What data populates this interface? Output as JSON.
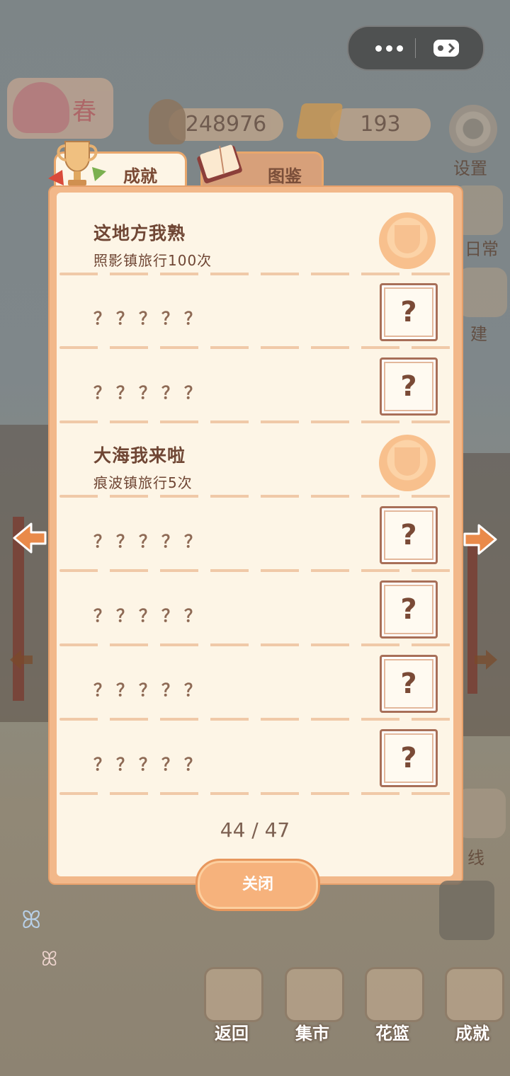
{
  "top_bar": {
    "season_label": "春",
    "fish_count": "248976",
    "cheese_count": "193"
  },
  "side_menu": {
    "settings_label": "设置",
    "daily_label": "日常",
    "build_label": "建",
    "route_label": "线"
  },
  "tabs": [
    {
      "label": "成就",
      "active": true
    },
    {
      "label": "图鉴",
      "active": false
    }
  ],
  "achievements": [
    {
      "title": "这地方我熟",
      "desc": "照影镇旅行100次",
      "unlocked": true
    },
    {
      "title": "？？？？？",
      "desc": "",
      "unlocked": false
    },
    {
      "title": "？？？？？",
      "desc": "",
      "unlocked": false
    },
    {
      "title": "大海我来啦",
      "desc": "痕波镇旅行5次",
      "unlocked": true
    },
    {
      "title": "？？？？？",
      "desc": "",
      "unlocked": false
    },
    {
      "title": "？？？？？",
      "desc": "",
      "unlocked": false
    },
    {
      "title": "？？？？？",
      "desc": "",
      "unlocked": false
    },
    {
      "title": "？？？？？",
      "desc": "",
      "unlocked": false
    }
  ],
  "locked_symbol": "?",
  "counter": "44 / 47",
  "close_label": "关闭",
  "bottom_nav": [
    {
      "label": "返回"
    },
    {
      "label": "集市"
    },
    {
      "label": "花篮"
    },
    {
      "label": "成就"
    }
  ],
  "colors": {
    "panel_bg": "#fdf5e6",
    "panel_border": "#f2b88a",
    "text_brown": "#6f4634",
    "button_orange": "#f6b27c",
    "arrow_orange": "#e98a4a"
  }
}
